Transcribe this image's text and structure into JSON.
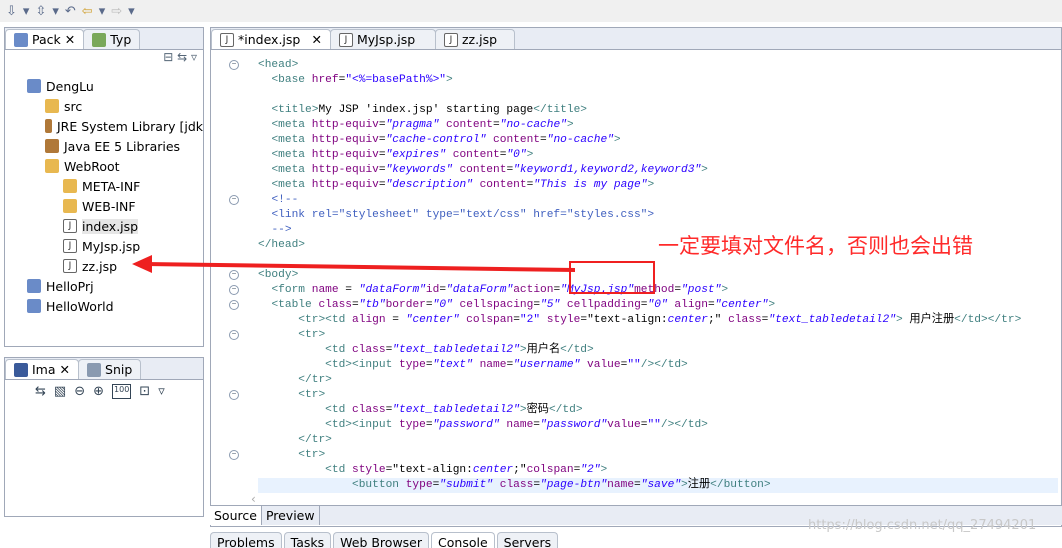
{
  "toolbar": {
    "icons": [
      "down-arrow-icon",
      "dropdown-icon",
      "jump-icon",
      "dropdown-icon",
      "back-history-icon",
      "back-icon",
      "dropdown-icon",
      "forward-icon",
      "dropdown-icon"
    ]
  },
  "explorer": {
    "tabs": [
      {
        "label": "Pack",
        "close": "✕"
      },
      {
        "label": "Typ"
      }
    ],
    "items": [
      {
        "label": "DengLu",
        "icon": "project",
        "level": 0
      },
      {
        "label": "src",
        "icon": "package-folder",
        "level": 1
      },
      {
        "label": "JRE System Library [jdk",
        "icon": "library",
        "level": 1
      },
      {
        "label": "Java EE 5 Libraries",
        "icon": "library",
        "level": 1
      },
      {
        "label": "WebRoot",
        "icon": "folder",
        "level": 1
      },
      {
        "label": "META-INF",
        "icon": "folder",
        "level": 2
      },
      {
        "label": "WEB-INF",
        "icon": "folder",
        "level": 2
      },
      {
        "label": "index.jsp",
        "icon": "jsp-file",
        "level": 2,
        "selected": true
      },
      {
        "label": "MyJsp.jsp",
        "icon": "jsp-file",
        "level": 2
      },
      {
        "label": "zz.jsp",
        "icon": "jsp-file",
        "level": 2
      },
      {
        "label": "HelloPrj",
        "icon": "project",
        "level": 0
      },
      {
        "label": "HelloWorld",
        "icon": "project",
        "level": 0
      }
    ]
  },
  "image_panel": {
    "tabs": [
      {
        "label": "Ima",
        "close": "✕"
      },
      {
        "label": "Snip"
      }
    ]
  },
  "editor": {
    "tabs": [
      {
        "label": "*index.jsp",
        "close": "✕"
      },
      {
        "label": "MyJsp.jsp"
      },
      {
        "label": "zz.jsp"
      }
    ],
    "bottom_tabs": [
      "Source",
      "Preview"
    ],
    "lines": [
      [
        0,
        [
          [
            "tag",
            "<head>"
          ]
        ],
        "fold"
      ],
      [
        1,
        [
          [
            "tag",
            "<base "
          ],
          [
            "attr",
            "href"
          ],
          [
            "text",
            "="
          ],
          [
            "str",
            "\"<%=basePath%>\""
          ],
          [
            "tag",
            ">"
          ]
        ]
      ],
      [
        0,
        []
      ],
      [
        1,
        [
          [
            "tag",
            "<title>"
          ],
          [
            "text",
            "My JSP 'index.jsp' starting page"
          ],
          [
            "tag",
            "</title>"
          ]
        ]
      ],
      [
        1,
        [
          [
            "tag",
            "<meta "
          ],
          [
            "attr",
            "http-equiv"
          ],
          [
            "text",
            "="
          ],
          [
            "val",
            "\"pragma\""
          ],
          [
            "attr",
            " content"
          ],
          [
            "text",
            "="
          ],
          [
            "val",
            "\"no-cache\""
          ],
          [
            "tag",
            ">"
          ]
        ]
      ],
      [
        1,
        [
          [
            "tag",
            "<meta "
          ],
          [
            "attr",
            "http-equiv"
          ],
          [
            "text",
            "="
          ],
          [
            "val",
            "\"cache-control\""
          ],
          [
            "attr",
            " content"
          ],
          [
            "text",
            "="
          ],
          [
            "val",
            "\"no-cache\""
          ],
          [
            "tag",
            ">"
          ]
        ]
      ],
      [
        1,
        [
          [
            "tag",
            "<meta "
          ],
          [
            "attr",
            "http-equiv"
          ],
          [
            "text",
            "="
          ],
          [
            "val",
            "\"expires\""
          ],
          [
            "attr",
            " content"
          ],
          [
            "text",
            "="
          ],
          [
            "val",
            "\"0\""
          ],
          [
            "tag",
            ">"
          ]
        ]
      ],
      [
        1,
        [
          [
            "tag",
            "<meta "
          ],
          [
            "attr",
            "http-equiv"
          ],
          [
            "text",
            "="
          ],
          [
            "val",
            "\"keywords\""
          ],
          [
            "attr",
            " content"
          ],
          [
            "text",
            "="
          ],
          [
            "val",
            "\"keyword1,keyword2,keyword3\""
          ],
          [
            "tag",
            ">"
          ]
        ]
      ],
      [
        1,
        [
          [
            "tag",
            "<meta "
          ],
          [
            "attr",
            "http-equiv"
          ],
          [
            "text",
            "="
          ],
          [
            "val",
            "\"description\""
          ],
          [
            "attr",
            " content"
          ],
          [
            "text",
            "="
          ],
          [
            "val",
            "\"This is my page\""
          ],
          [
            "tag",
            ">"
          ]
        ]
      ],
      [
        1,
        [
          [
            "com",
            "<!--"
          ]
        ],
        "fold"
      ],
      [
        1,
        [
          [
            "com",
            "<link rel=\"stylesheet\" type=\"text/css\" href=\"styles.css\">"
          ]
        ]
      ],
      [
        1,
        [
          [
            "com",
            "-->"
          ]
        ]
      ],
      [
        0,
        [
          [
            "tag",
            "</head>"
          ]
        ]
      ],
      [
        0,
        []
      ],
      [
        0,
        [
          [
            "tag",
            "<body>"
          ]
        ],
        "fold"
      ],
      [
        1,
        [
          [
            "tag",
            "<form "
          ],
          [
            "attr",
            "name"
          ],
          [
            "text",
            " = "
          ],
          [
            "val",
            "\"dataForm\""
          ],
          [
            "attr",
            "id"
          ],
          [
            "text",
            "="
          ],
          [
            "val",
            "\"dataForm\""
          ],
          [
            "attr",
            "action"
          ],
          [
            "text",
            "="
          ],
          [
            "val",
            "\"MyJsp.jsp\""
          ],
          [
            "attr",
            "method"
          ],
          [
            "text",
            "="
          ],
          [
            "val",
            "\"post\""
          ],
          [
            "tag",
            ">"
          ]
        ],
        "fold"
      ],
      [
        1,
        [
          [
            "tag",
            "<table "
          ],
          [
            "attr",
            "class"
          ],
          [
            "text",
            "="
          ],
          [
            "val",
            "\"tb\""
          ],
          [
            "attr",
            "border"
          ],
          [
            "text",
            "="
          ],
          [
            "val",
            "\"0\""
          ],
          [
            "attr",
            " cellspacing"
          ],
          [
            "text",
            "="
          ],
          [
            "val",
            "\"5\""
          ],
          [
            "attr",
            " cellpadding"
          ],
          [
            "text",
            "="
          ],
          [
            "val",
            "\"0\""
          ],
          [
            "attr",
            " align"
          ],
          [
            "text",
            "="
          ],
          [
            "val",
            "\"center\""
          ],
          [
            "tag",
            ">"
          ]
        ],
        "fold"
      ],
      [
        2,
        [
          [
            "tag",
            "<tr><td "
          ],
          [
            "attr",
            "align"
          ],
          [
            "text",
            " = "
          ],
          [
            "val",
            "\"center\""
          ],
          [
            "attr",
            " colspan"
          ],
          [
            "text",
            "="
          ],
          [
            "str",
            "\"2\""
          ],
          [
            "attr",
            " style"
          ],
          [
            "text",
            "=\"text-align:"
          ],
          [
            "val",
            "center"
          ],
          [
            "text",
            ";\""
          ],
          [
            "attr",
            " class"
          ],
          [
            "text",
            "="
          ],
          [
            "val",
            "\"text_tabledetail2\""
          ],
          [
            "tag",
            ">"
          ],
          [
            "text",
            " 用户注册"
          ],
          [
            "tag",
            "</td></tr>"
          ]
        ]
      ],
      [
        2,
        [
          [
            "tag",
            "<tr>"
          ]
        ],
        "fold"
      ],
      [
        3,
        [
          [
            "tag",
            "<td "
          ],
          [
            "attr",
            "class"
          ],
          [
            "text",
            "="
          ],
          [
            "val",
            "\"text_tabledetail2\""
          ],
          [
            "tag",
            ">"
          ],
          [
            "text",
            "用户名"
          ],
          [
            "tag",
            "</td>"
          ]
        ]
      ],
      [
        3,
        [
          [
            "tag",
            "<td><input "
          ],
          [
            "attr",
            "type"
          ],
          [
            "text",
            "="
          ],
          [
            "val",
            "\"text\""
          ],
          [
            "attr",
            " name"
          ],
          [
            "text",
            "="
          ],
          [
            "val",
            "\"username\""
          ],
          [
            "attr",
            " value"
          ],
          [
            "text",
            "="
          ],
          [
            "str",
            "\"\""
          ],
          [
            "tag",
            "/></td>"
          ]
        ]
      ],
      [
        2,
        [
          [
            "tag",
            "</tr>"
          ]
        ]
      ],
      [
        2,
        [
          [
            "tag",
            "<tr>"
          ]
        ],
        "fold"
      ],
      [
        3,
        [
          [
            "tag",
            "<td "
          ],
          [
            "attr",
            "class"
          ],
          [
            "text",
            "="
          ],
          [
            "val",
            "\"text_tabledetail2\""
          ],
          [
            "tag",
            ">"
          ],
          [
            "text",
            "密码"
          ],
          [
            "tag",
            "</td>"
          ]
        ]
      ],
      [
        3,
        [
          [
            "tag",
            "<td><input "
          ],
          [
            "attr",
            "type"
          ],
          [
            "text",
            "="
          ],
          [
            "val",
            "\"password\""
          ],
          [
            "attr",
            " name"
          ],
          [
            "text",
            "="
          ],
          [
            "val",
            "\"password\""
          ],
          [
            "attr",
            "value"
          ],
          [
            "text",
            "="
          ],
          [
            "str",
            "\"\""
          ],
          [
            "tag",
            "/></td>"
          ]
        ]
      ],
      [
        2,
        [
          [
            "tag",
            "</tr>"
          ]
        ]
      ],
      [
        2,
        [
          [
            "tag",
            "<tr>"
          ]
        ],
        "fold"
      ],
      [
        3,
        [
          [
            "tag",
            "<td "
          ],
          [
            "attr",
            "style"
          ],
          [
            "text",
            "=\"text-align:"
          ],
          [
            "val",
            "center"
          ],
          [
            "text",
            ";\""
          ],
          [
            "attr",
            "colspan"
          ],
          [
            "text",
            "="
          ],
          [
            "val",
            "\"2\""
          ],
          [
            "tag",
            ">"
          ]
        ]
      ],
      [
        4,
        [
          [
            "tag",
            "<button "
          ],
          [
            "attr",
            "type"
          ],
          [
            "text",
            "="
          ],
          [
            "val",
            "\"submit\""
          ],
          [
            "attr",
            " class"
          ],
          [
            "text",
            "="
          ],
          [
            "val",
            "\"page-btn\""
          ],
          [
            "attr",
            "name"
          ],
          [
            "text",
            "="
          ],
          [
            "val",
            "\"save\""
          ],
          [
            "tag",
            ">"
          ],
          [
            "text",
            "注册"
          ],
          [
            "tag",
            "</button>"
          ]
        ],
        "cur"
      ]
    ]
  },
  "console_tabs": [
    "Problems",
    "Tasks",
    "Web Browser",
    "Console",
    "Servers"
  ],
  "annotation": {
    "text": "一定要填对文件名，否则也会出错",
    "color": "#ff2a2a"
  },
  "watermark": "https://blog.csdn.net/qq_27494201"
}
